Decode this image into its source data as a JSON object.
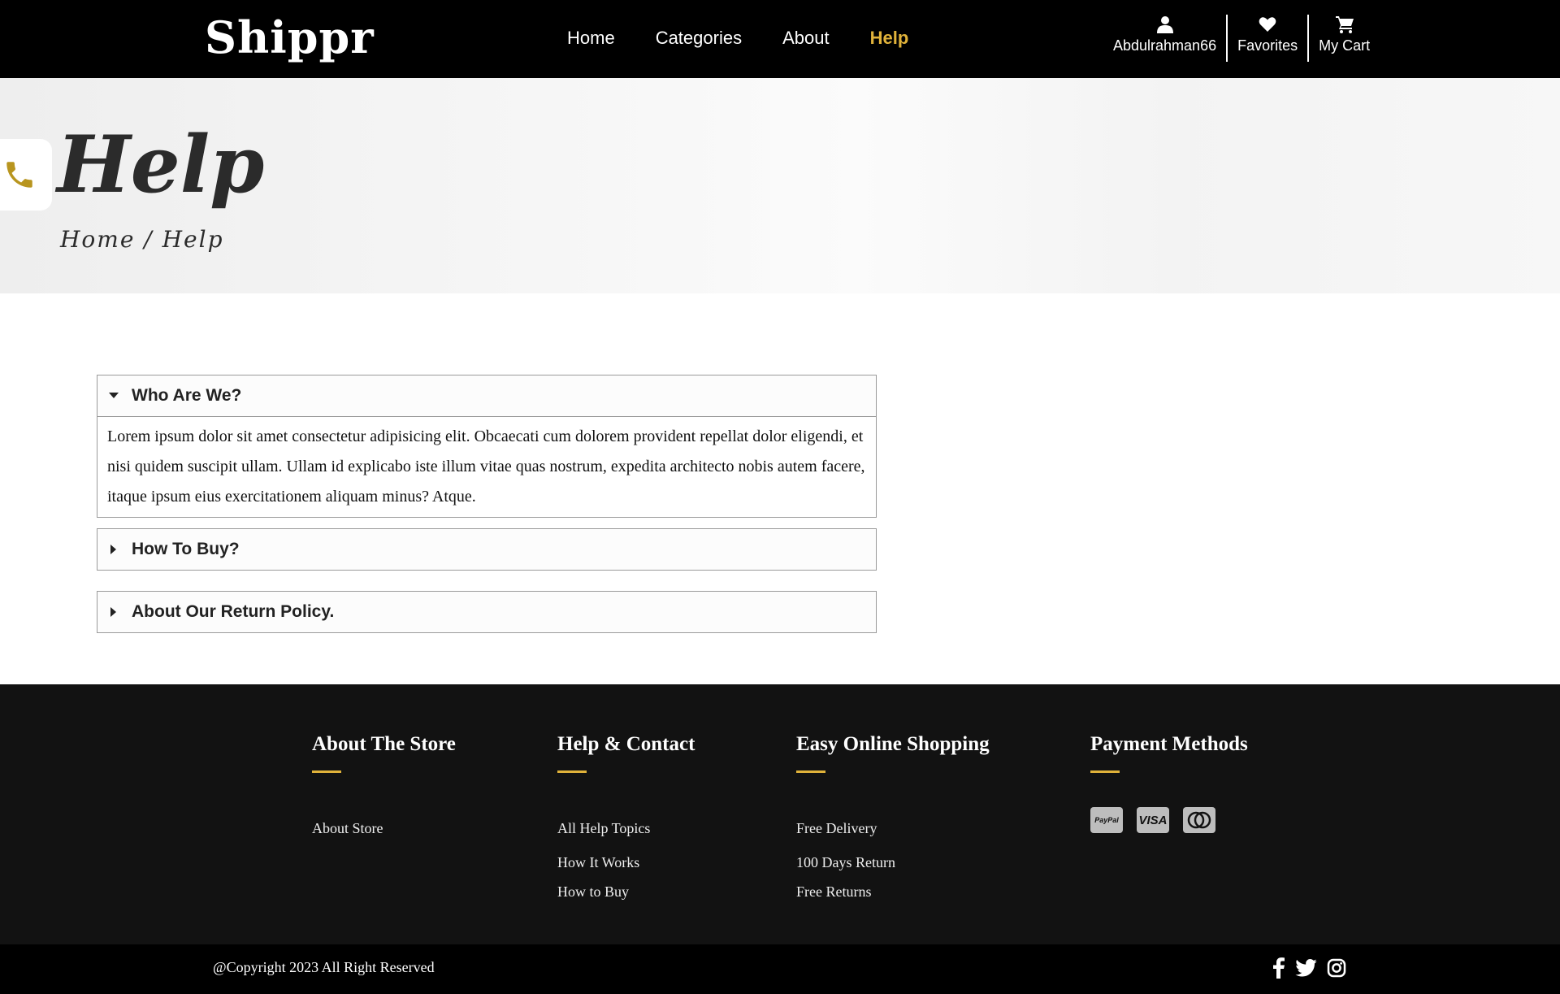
{
  "header": {
    "logo": "Shippr",
    "nav": [
      {
        "label": "Home",
        "active": false
      },
      {
        "label": "Categories",
        "active": false
      },
      {
        "label": "About",
        "active": false
      },
      {
        "label": "Help",
        "active": true
      }
    ],
    "user": {
      "account_label": "Abdulrahman66",
      "account_icon": "user-icon",
      "favorites_label": "Favorites",
      "favorites_icon": "heart-icon",
      "cart_label": "My Cart",
      "cart_icon": "cart-icon"
    }
  },
  "hero": {
    "title": "Help",
    "breadcrumb": "Home / Help",
    "phone_icon": "phone-icon"
  },
  "faq": [
    {
      "question": "Who Are We?",
      "expanded": true,
      "answer": "Lorem ipsum dolor sit amet consectetur adipisicing elit. Obcaecati cum dolorem provident repellat dolor eligendi, et nisi quidem suscipit ullam. Ullam id explicabo iste illum vitae quas nostrum, expedita architecto nobis autem facere, itaque ipsum eius exercitationem aliquam minus? Atque."
    },
    {
      "question": "How To Buy?",
      "expanded": false
    },
    {
      "question": "About Our Return Policy.",
      "expanded": false
    }
  ],
  "footer": {
    "columns": [
      {
        "title": "About The Store",
        "links": [
          "About Store"
        ]
      },
      {
        "title": "Help & Contact",
        "links": [
          "All Help Topics",
          "How It Works",
          "How to Buy"
        ]
      },
      {
        "title": "Easy Online Shopping",
        "links": [
          "Free Delivery",
          "100 Days Return",
          "Free Returns"
        ]
      },
      {
        "title": "Payment Methods",
        "payment_icons": [
          "paypal-icon",
          "visa-icon",
          "mastercard-icon"
        ],
        "payment_text": {
          "paypal": "PayPal",
          "visa": "VISA"
        }
      }
    ],
    "copyright": "@Copyright 2023 All Right Reserved",
    "social_icons": [
      "facebook-icon",
      "twitter-icon",
      "instagram-icon"
    ]
  },
  "colors": {
    "accent": "#e0b23a",
    "header_bg": "#000000",
    "footer_bg": "#121212"
  }
}
